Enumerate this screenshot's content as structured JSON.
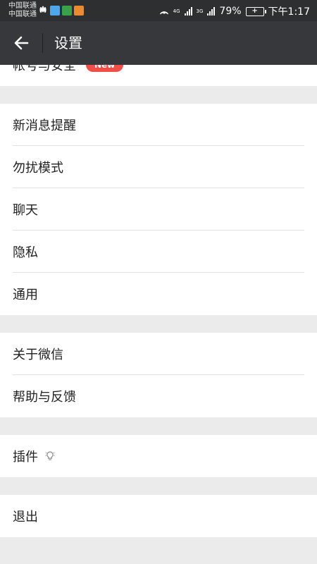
{
  "status_bar": {
    "carrier_line1": "中国联通",
    "carrier_line2": "中国联通",
    "net_label_1": "4G",
    "net_label_2": "3G",
    "battery_percent": "79%",
    "time": "下午1:17"
  },
  "header": {
    "title": "设置"
  },
  "settings": {
    "account": {
      "label": "帐号与安全",
      "badge": "New"
    },
    "group2": [
      {
        "label": "新消息提醒"
      },
      {
        "label": "勿扰模式"
      },
      {
        "label": "聊天"
      },
      {
        "label": "隐私"
      },
      {
        "label": "通用"
      }
    ],
    "group3": [
      {
        "label": "关于微信"
      },
      {
        "label": "帮助与反馈"
      }
    ],
    "plugins": {
      "label": "插件"
    },
    "logout": {
      "label": "退出"
    }
  },
  "colors": {
    "header_bg": "#37383b",
    "status_bg": "#2e2f31",
    "badge_red": "#f04e49",
    "page_bg": "#ebebeb"
  }
}
